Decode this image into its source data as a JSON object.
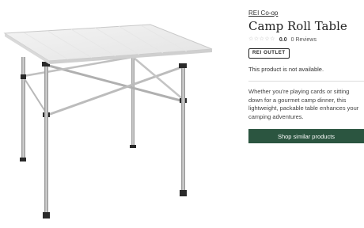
{
  "product": {
    "brand": "REI Co-op",
    "title": "Camp Roll Table",
    "rating_score": "0.0",
    "reviews_count": "0",
    "reviews_label": "Reviews",
    "stars_filled": 0,
    "stars_total": 5,
    "outlet_badge": "REI OUTLET",
    "availability": "This product is not available.",
    "description": "Whether you're playing cards or sitting down for a gourmet camp dinner, this lightweight, packable table enhances your camping adventures.",
    "cta_label": "Shop similar products"
  },
  "image": {
    "icon": "camp-table-photo"
  },
  "colors": {
    "cta": "#2b5540",
    "star_empty": "#b8b8b8",
    "text": "#2b2b2b"
  }
}
